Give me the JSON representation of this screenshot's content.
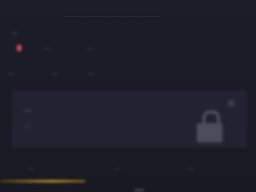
{
  "header": {
    "title": "...",
    "subtitle": "..."
  },
  "section": {
    "label": "...",
    "tab_a": "...",
    "tab_b": "..."
  },
  "rows": {
    "item_a": "...",
    "item_b": "...",
    "item_c": "..."
  },
  "card": {
    "line1": "...",
    "line2": "...",
    "hint": "...",
    "lock_icon": "lock-icon"
  },
  "footer": {
    "left": "...",
    "mid": "...",
    "right": "..."
  },
  "progress": {
    "fraction": 0.33
  },
  "colors": {
    "accent_gold": "#c79a26",
    "alert_red": "#c94a52"
  }
}
